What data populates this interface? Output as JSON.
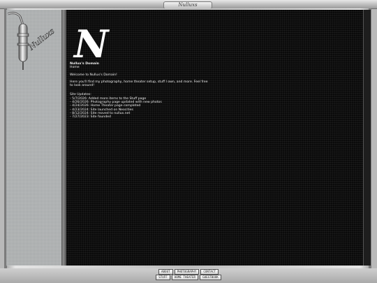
{
  "window": {
    "title": "Nulluxs"
  },
  "sidebar": {
    "logo_text": "Nulluxs"
  },
  "main": {
    "logo_letter": "N",
    "site_title": "Nullux's Domain",
    "breadcrumb": "Home",
    "welcome": "Welcome to Nullux's Domain!",
    "intro": "Here you'll find my photography, home theater setup, stuff I own, and more. Feel free to look around!",
    "updates_heading": "Site Updates:",
    "updates": [
      "- 5/7/2026: Added more items to the Stuff page",
      "- 4/26/2026: Photography page updated with new photos",
      "- 4/24/2026: Home Theater page completed",
      "- 4/23/2024: Site launched on Neocities",
      "- 8/12/2024: Site moved to nullux.net",
      "- 7/27/2023: Site founded"
    ]
  },
  "nav": {
    "row1": [
      "ABOUT",
      "PHOTOGRAPHY",
      "CONTACT"
    ],
    "row2": [
      "STUFF",
      "HOME THEATER",
      "GUESTBOOK"
    ]
  },
  "colors": {
    "main_bg": "#0a0a0a",
    "sidebar_bg": "#aeb1b2",
    "text": "#f0f0f0"
  }
}
